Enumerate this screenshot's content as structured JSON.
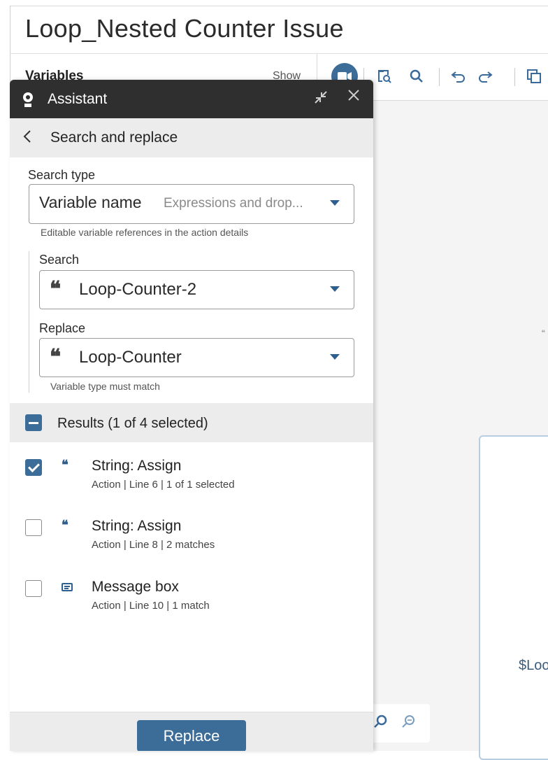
{
  "page": {
    "title": "Loop_Nested Counter Issue",
    "variables_label": "Variables",
    "show_label": "Show"
  },
  "toolbar": {
    "icons": [
      "record-icon",
      "find-in-flow-icon",
      "search-icon",
      "undo-icon",
      "redo-icon",
      "copy-icon"
    ]
  },
  "canvas": {
    "quote_mark": "“",
    "node_text": "$Loo"
  },
  "assistant": {
    "title": "Assistant",
    "subheader": "Search and replace",
    "search_type_label": "Search type",
    "search_type_value": "Variable name",
    "search_type_sub": "Expressions and drop...",
    "search_type_hint": "Editable variable references in the action details",
    "search_label": "Search",
    "search_value": "Loop-Counter-2",
    "replace_label": "Replace",
    "replace_value": "Loop-Counter",
    "replace_hint": "Variable type must match",
    "results_label": "Results (1 of 4 selected)",
    "results": [
      {
        "title": "String: Assign",
        "meta": "Action | Line 6 | 1 of 1 selected",
        "checked": true,
        "icon": "quote-icon"
      },
      {
        "title": "String: Assign",
        "meta": "Action | Line 8 | 2 matches",
        "checked": false,
        "icon": "quote-icon"
      },
      {
        "title": "Message box",
        "meta": "Action | Line 10 | 1 match",
        "checked": false,
        "icon": "message-box-icon"
      }
    ],
    "replace_button": "Replace"
  },
  "colors": {
    "accent": "#3c6c98",
    "header_bg": "#2f2f2f",
    "section_bg": "#ececec"
  }
}
